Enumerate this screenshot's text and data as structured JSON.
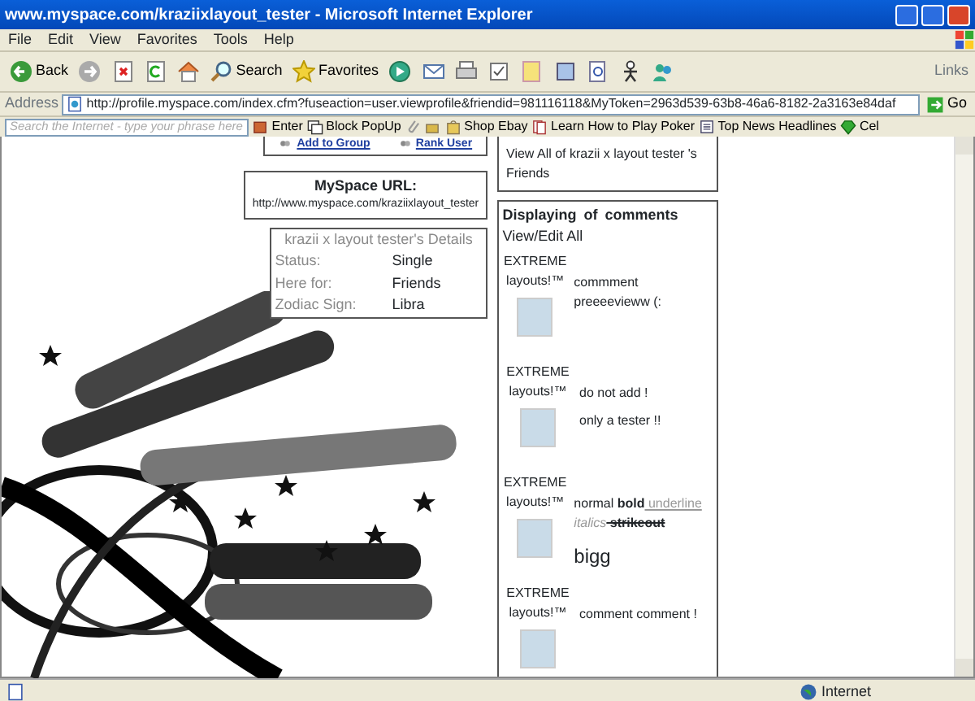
{
  "window": {
    "title": "www.myspace.com/kraziixlayout_tester - Microsoft Internet Explorer"
  },
  "menu": [
    "File",
    "Edit",
    "View",
    "Favorites",
    "Tools",
    "Help"
  ],
  "toolbar": [
    {
      "kind": "back",
      "label": "Back"
    },
    {
      "kind": "forward"
    },
    {
      "kind": "stop"
    },
    {
      "kind": "refresh"
    },
    {
      "kind": "home"
    },
    {
      "kind": "search",
      "label": "Search"
    },
    {
      "kind": "favorites",
      "label": "Favorites"
    },
    {
      "kind": "media"
    },
    {
      "kind": "mail"
    },
    {
      "kind": "print"
    },
    {
      "kind": "edit"
    },
    {
      "kind": "note"
    },
    {
      "kind": "research"
    },
    {
      "kind": "find"
    },
    {
      "kind": "messenger"
    },
    {
      "kind": "contacts"
    }
  ],
  "links_label": "Links",
  "address": {
    "label": "Address",
    "value": "http://profile.myspace.com/index.cfm?fuseaction=user.viewprofile&friendid=981116118&MyToken=2963d539-63b8-46a6-8182-2a3163e84daf",
    "go": "Go"
  },
  "search_toolbar": {
    "placeholder": "Search the Internet - type your phrase here",
    "items": [
      {
        "kind": "enter",
        "label": "Enter"
      },
      {
        "kind": "popup",
        "label": "Block PopUp"
      },
      {
        "kind": "clip"
      },
      {
        "kind": "bag"
      },
      {
        "kind": "cart",
        "label": "Shop Ebay"
      },
      {
        "kind": "cards",
        "label": "Learn How to Play Poker"
      },
      {
        "kind": "news",
        "label": "Top News Headlines"
      },
      {
        "kind": "phone",
        "label": "Cel"
      }
    ]
  },
  "profile": {
    "group_links": [
      "Add to Group",
      "Rank User"
    ],
    "url_box": {
      "heading": "MySpace URL:",
      "url": "http://www.myspace.com/kraziixlayout_tester"
    },
    "details": {
      "title": "krazii x layout tester's Details",
      "rows": [
        {
          "label": "Status:",
          "value": "Single"
        },
        {
          "label": "Here for:",
          "value": "Friends"
        },
        {
          "label": "Zodiac Sign:",
          "value": "Libra"
        }
      ]
    }
  },
  "friends": {
    "link": "View All of krazii x layout tester 's Friends"
  },
  "comments": {
    "displaying": "Displaying",
    "of": "of",
    "comments": "comments",
    "view_all": "View/Edit All",
    "items": [
      {
        "author": "EXTREME layouts!™",
        "lines": [
          [
            {
              "text": "commment preeeevieww (:",
              "kind": "plain"
            }
          ]
        ]
      },
      {
        "author": "EXTREME layouts!™",
        "lines": [
          [
            {
              "text": "do not add !",
              "kind": "plain"
            }
          ],
          [
            {
              "text": "only a tester !!",
              "kind": "plain"
            }
          ]
        ]
      },
      {
        "author": "EXTREME layouts!™",
        "lines": [
          [
            {
              "text": "normal ",
              "kind": "plain"
            },
            {
              "text": "bold",
              "kind": "bold"
            },
            {
              "text": " underline",
              "kind": "underline"
            },
            {
              "text": " italics",
              "kind": "italic"
            },
            {
              "text": " strikeout",
              "kind": "strike"
            }
          ],
          [
            {
              "text": "bigg",
              "kind": "big"
            }
          ]
        ]
      },
      {
        "author": "EXTREME layouts!™",
        "lines": [
          [
            {
              "text": "comment comment !",
              "kind": "plain"
            }
          ]
        ]
      }
    ]
  },
  "status_bar": {
    "zone": "Internet"
  }
}
